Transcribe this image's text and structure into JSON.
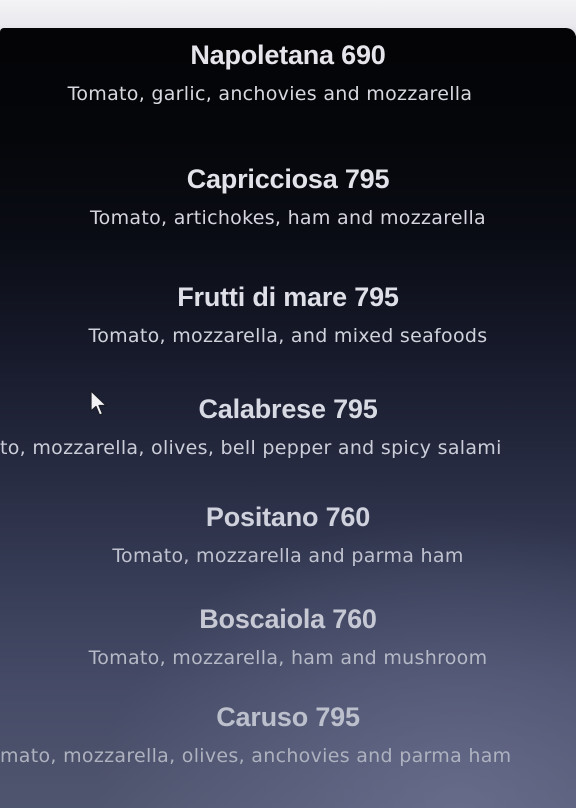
{
  "menu": {
    "items": [
      {
        "title": "Napoletana 690",
        "description": "Tomato, garlic, anchovies and mozzarella",
        "title_color": "#e4e4ea",
        "desc_color": "#d7d8e0"
      },
      {
        "title": "Capricciosa 795",
        "description": "Tomato, artichokes, ham and mozzarella",
        "title_color": "#e2e3ea",
        "desc_color": "#d4d5de"
      },
      {
        "title": "Frutti di mare 795",
        "description": "Tomato, mozzarella, and mixed seafoods",
        "title_color": "#dedfe7",
        "desc_color": "#d0d2dc"
      },
      {
        "title": "Calabrese 795",
        "description": "to, mozzarella, olives, bell pepper and spicy salami",
        "title_color": "#d8dae3",
        "desc_color": "#cbcdd8"
      },
      {
        "title": "Positano 760",
        "description": "Tomato, mozzarella and parma ham",
        "title_color": "#cfd1dc",
        "desc_color": "#c0c3cf"
      },
      {
        "title": "Boscaiola 760",
        "description": "Tomato, mozzarella, ham and mushroom",
        "title_color": "#c6c9d4",
        "desc_color": "#b6b9c6"
      },
      {
        "title": "Caruso 795",
        "description": "mato, mozzarella, olives, anchovies and parma ham",
        "title_color": "#bcc0cc",
        "desc_color": "#aeb2bf"
      }
    ]
  },
  "cursor": {
    "icon": "mouse-pointer-icon",
    "color": "#f2f2f4"
  }
}
